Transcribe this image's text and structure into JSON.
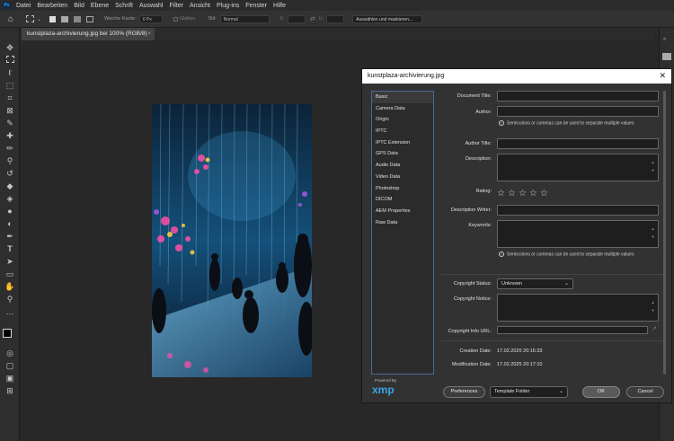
{
  "app": {
    "logo": "Ps",
    "menu": [
      "Datei",
      "Bearbeiten",
      "Bild",
      "Ebene",
      "Schrift",
      "Auswahl",
      "Filter",
      "Ansicht",
      "Plug-ins",
      "Fenster",
      "Hilfe"
    ]
  },
  "options_bar": {
    "feather_label": "Weiche Kante:",
    "feather_value": "0 Px",
    "smooth_label": "Glätten",
    "style_label": "Stil:",
    "style_value": "Normal",
    "width_label": "B:",
    "height_label": "H:",
    "select_mask_button": "Auswählen und maskieren..."
  },
  "document_tab": {
    "title": "kunstplaza-archivierung.jpg bei 100% (RGB/8)",
    "close": "×"
  },
  "dialog": {
    "title": "kunstplaza-archivierung.jpg",
    "close": "✕",
    "categories": [
      "Basic",
      "Camera Data",
      "Origin",
      "IPTC",
      "IPTC Extension",
      "GPS Data",
      "Audio Data",
      "Video Data",
      "Photoshop",
      "DICOM",
      "AEM Properties",
      "Raw Data"
    ],
    "selected_category": "Basic",
    "powered_by": "Powered By",
    "xmp_logo": "xmp",
    "fields": {
      "document_title_label": "Document Title:",
      "author_label": "Author:",
      "author_note": "Semicolons or commas can be used to separate multiple values",
      "author_title_label": "Author Title:",
      "description_label": "Description:",
      "rating_label": "Rating:",
      "rating_value": 0,
      "rating_max": 5,
      "description_writer_label": "Description Writer:",
      "keywords_label": "Keywords:",
      "keywords_note": "Semicolons or commas can be used to separate multiple values",
      "copyright_status_label": "Copyright Status:",
      "copyright_status_value": "Unknown",
      "copyright_notice_label": "Copyright Notice:",
      "copyright_url_label": "Copyright Info URL:",
      "creation_date_label": "Creation Date:",
      "creation_date_value": "17.02.2025 20:16:33",
      "modification_date_label": "Modification Date:",
      "modification_date_value": "17.02.2025 20:17:10"
    },
    "buttons": {
      "preferences": "Preferences",
      "template_folder": "Template Folder",
      "ok": "OK",
      "cancel": "Cancel"
    }
  },
  "colors": {
    "accent_blue": "#3aa4e6",
    "dialog_bg": "#323232",
    "workspace_bg": "#282828"
  }
}
